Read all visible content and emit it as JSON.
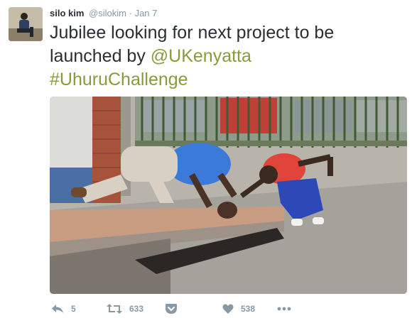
{
  "tweet": {
    "author_name": "silo kim",
    "author_handle": "@silokim",
    "separator": "·",
    "date": "Jan 7",
    "text_part1": "Jubilee looking for next project to be launched by ",
    "mention": "@UKenyatta",
    "hashtag": "#UhuruChallenge"
  },
  "actions": {
    "reply_count": "5",
    "retweet_count": "633",
    "like_count": "538"
  },
  "colors": {
    "link": "#8a9a3b",
    "muted": "#8899a6",
    "text": "#292f33"
  },
  "icons": [
    "reply-icon",
    "retweet-icon",
    "pocket-icon",
    "heart-icon",
    "more-icon"
  ]
}
